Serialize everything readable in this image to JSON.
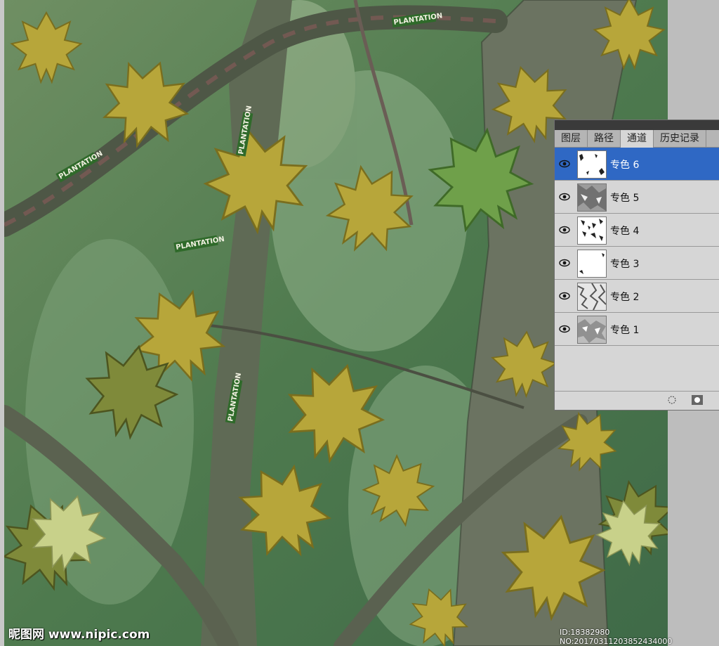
{
  "panel": {
    "tabs": [
      {
        "label": "图层",
        "active": false
      },
      {
        "label": "路径",
        "active": false
      },
      {
        "label": "通道",
        "active": true
      },
      {
        "label": "历史记录",
        "active": false
      }
    ],
    "channels": [
      {
        "label": "专色 6",
        "selected": true,
        "visible_icon": "eye-icon"
      },
      {
        "label": "专色 5",
        "selected": false,
        "visible_icon": "eye-icon"
      },
      {
        "label": "专色 4",
        "selected": false,
        "visible_icon": "eye-icon"
      },
      {
        "label": "专色 3",
        "selected": false,
        "visible_icon": "eye-icon"
      },
      {
        "label": "专色 2",
        "selected": false,
        "visible_icon": "eye-icon"
      },
      {
        "label": "专色 1",
        "selected": false,
        "visible_icon": "eye-icon"
      }
    ],
    "footer_icons": [
      "load-selection-icon",
      "save-mask-icon"
    ],
    "selected_color": "#2f68c4"
  },
  "image": {
    "description_icon": "camouflage-leaves-image",
    "label_text": "PLANTATION"
  },
  "watermark": {
    "site": "昵图网 www.nipic.com",
    "id_text": "ID:18382980 NO:20170311203852434000"
  }
}
